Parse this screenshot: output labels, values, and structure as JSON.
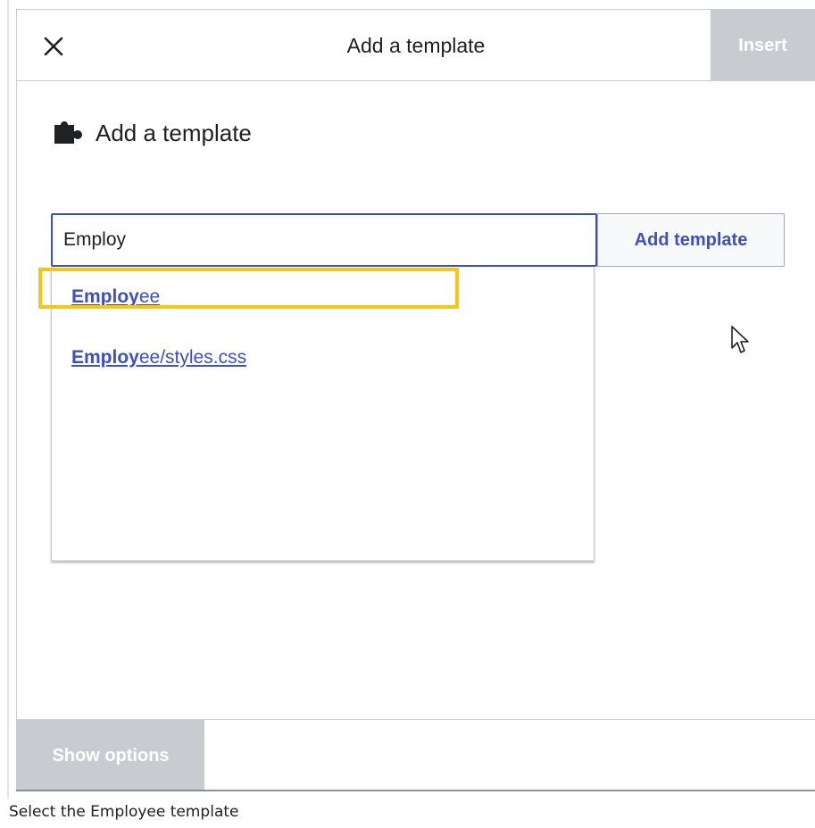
{
  "dialog": {
    "title": "Add a template",
    "insert_label": "Insert",
    "close_icon": "close-icon"
  },
  "section": {
    "title": "Add a template",
    "icon": "puzzle-icon"
  },
  "search": {
    "value": "Employ",
    "button_label": "Add template"
  },
  "suggestions": [
    {
      "match": "Employ",
      "rest": "ee"
    },
    {
      "match": "Employ",
      "rest": "ee/styles.css"
    }
  ],
  "footer": {
    "show_options_label": "Show options"
  },
  "caption": "Select the Employee template",
  "colors": {
    "accent": "#3f4fc0",
    "highlight": "#f5c518",
    "disabled_button": "#c8ccd1"
  }
}
